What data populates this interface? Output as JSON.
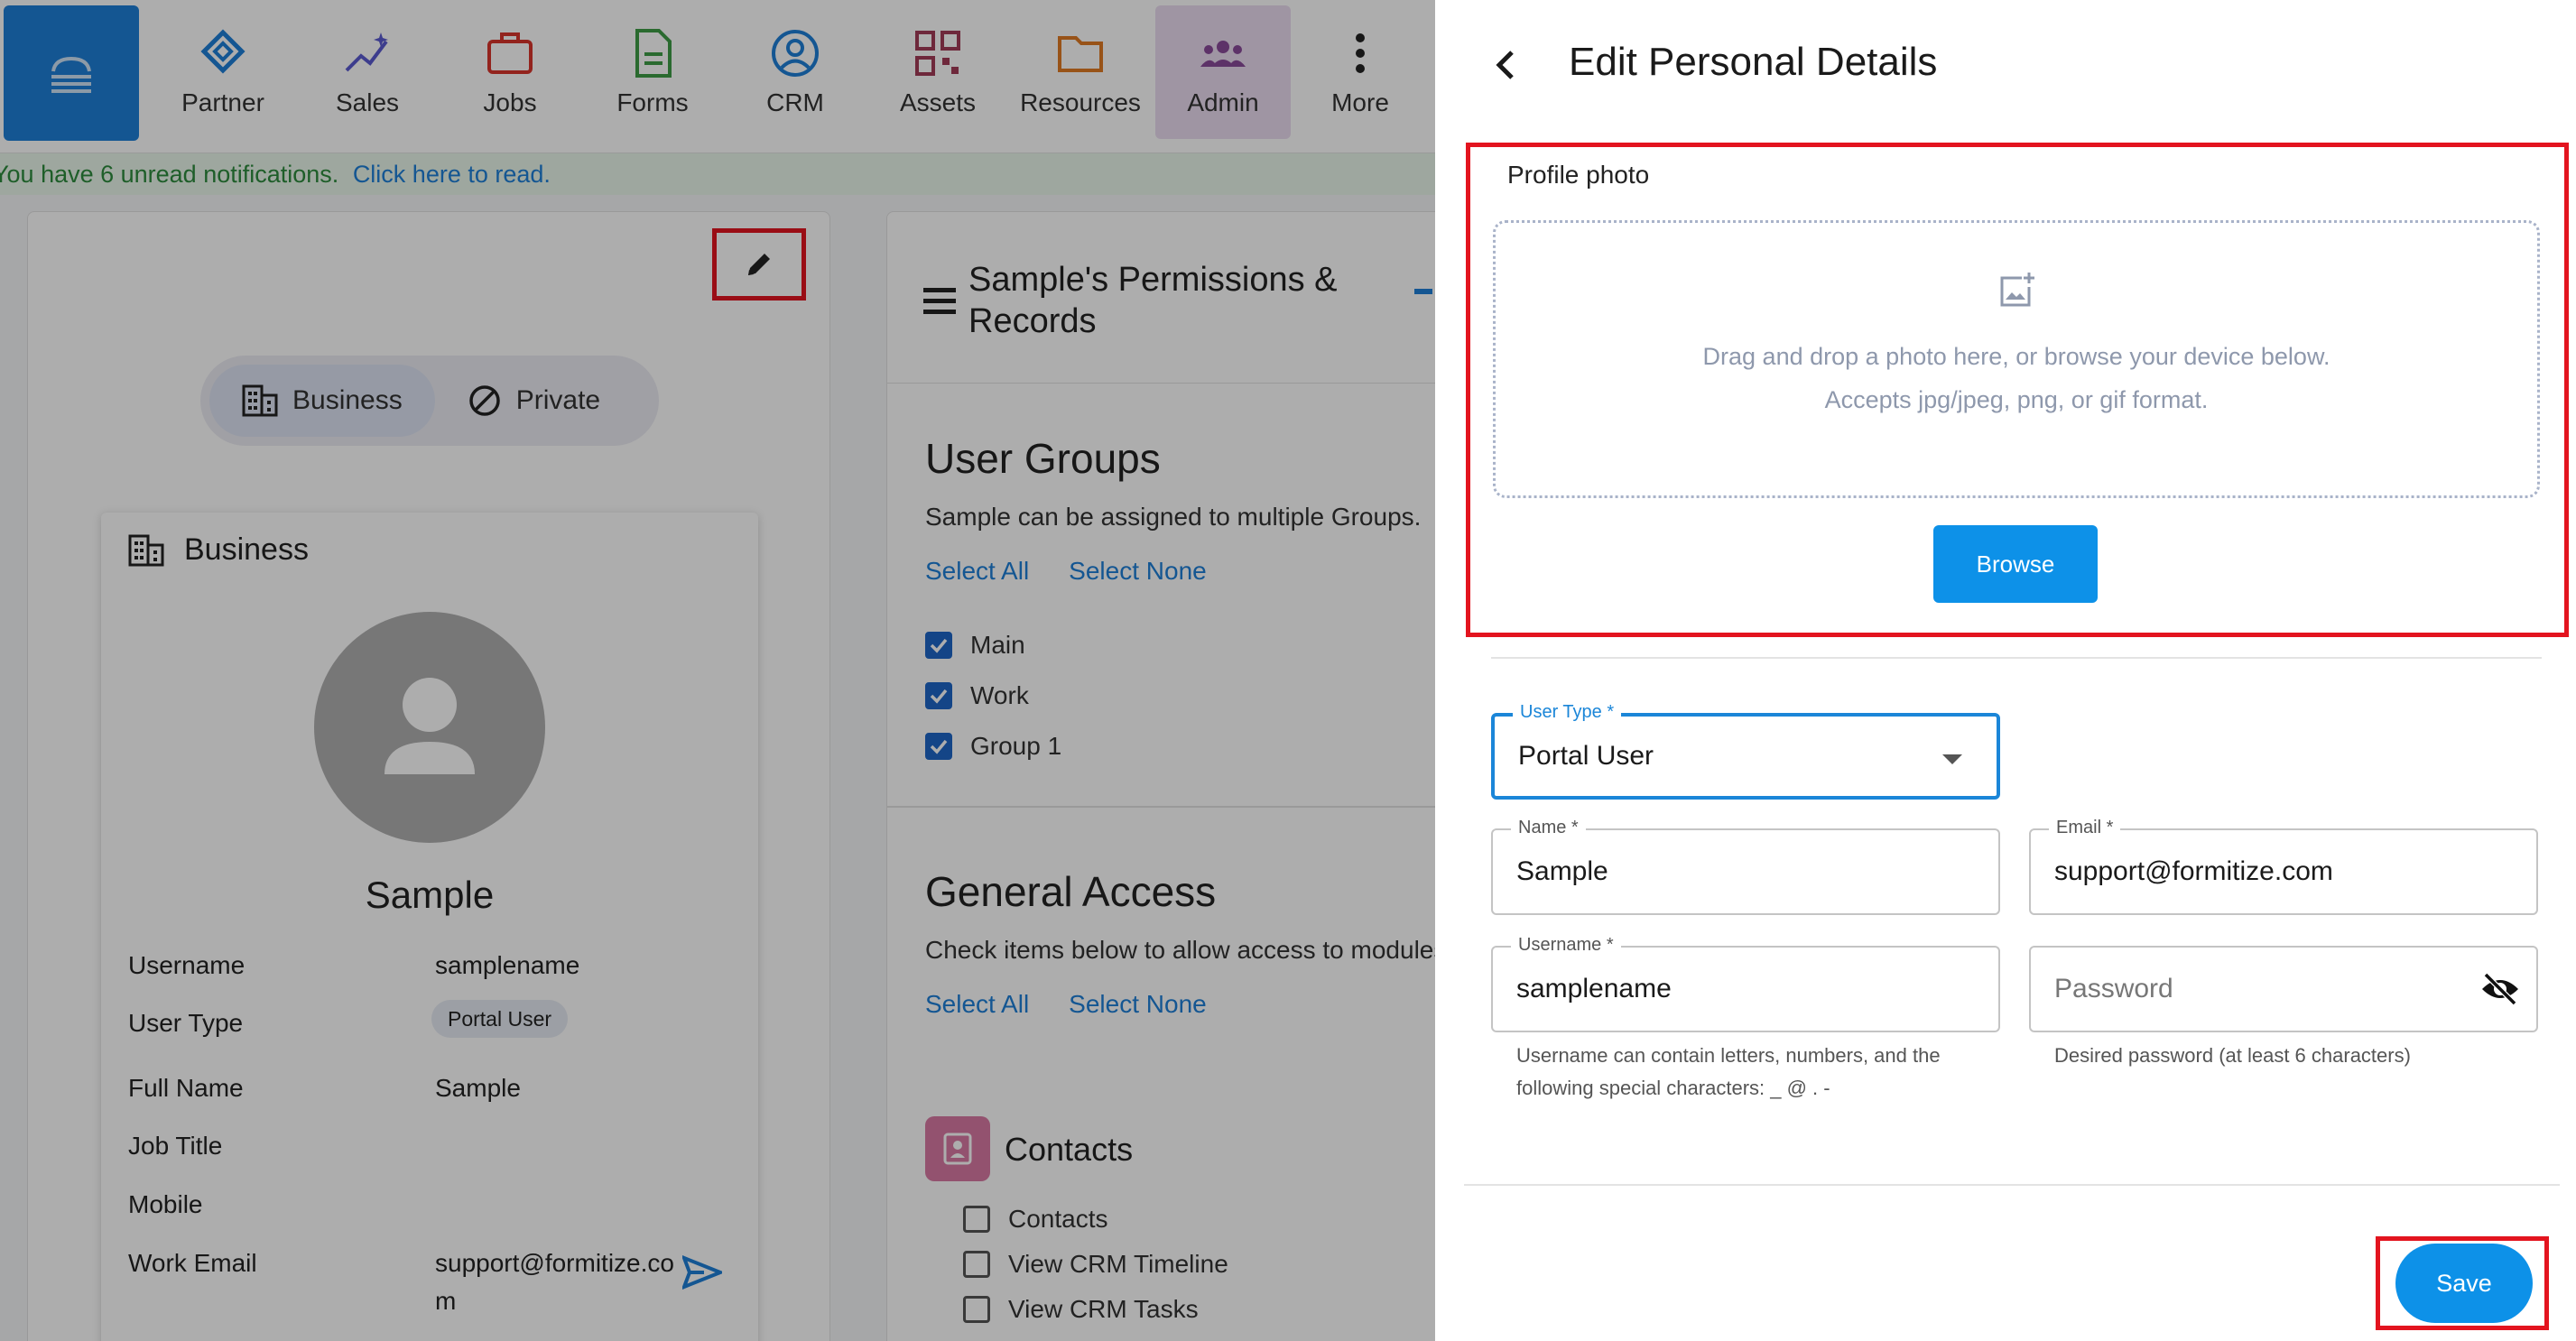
{
  "nav": {
    "items": [
      {
        "label": "Partner",
        "icon": "partner-icon"
      },
      {
        "label": "Sales",
        "icon": "sales-icon"
      },
      {
        "label": "Jobs",
        "icon": "briefcase-icon"
      },
      {
        "label": "Forms",
        "icon": "form-document-icon"
      },
      {
        "label": "CRM",
        "icon": "account-circle-icon"
      },
      {
        "label": "Assets",
        "icon": "qr-code-icon"
      },
      {
        "label": "Resources",
        "icon": "folder-icon"
      },
      {
        "label": "Admin",
        "icon": "group-icon"
      },
      {
        "label": "More",
        "icon": "more-vertical-icon"
      }
    ]
  },
  "notification": {
    "text": "You have 6 unread notifications.",
    "link": "Click here to read."
  },
  "profile": {
    "toggle": {
      "business": "Business",
      "private": "Private"
    },
    "card_title": "Business",
    "name": "Sample",
    "fields": [
      {
        "label": "Username",
        "value": "samplename"
      },
      {
        "label": "User Type",
        "value": "Portal User"
      },
      {
        "label": "Full Name",
        "value": "Sample"
      },
      {
        "label": "Job Title",
        "value": ""
      },
      {
        "label": "Mobile",
        "value": ""
      },
      {
        "label": "Work Email",
        "value": "support@formitize.co",
        "value_cont": "m"
      }
    ]
  },
  "permissions": {
    "title": "Sample's Permissions & Records",
    "user_groups": {
      "title": "User Groups",
      "subtitle": "Sample can be assigned to multiple Groups.",
      "select_all": "Select All",
      "select_none": "Select None",
      "groups": [
        {
          "label": "Main",
          "checked": true
        },
        {
          "label": "Work",
          "checked": true
        },
        {
          "label": "Group 1",
          "checked": true
        }
      ]
    },
    "general_access": {
      "title": "General Access",
      "subtitle": "Check items below to allow access to modules",
      "select_all": "Select All",
      "select_none": "Select None"
    },
    "contacts": {
      "title": "Contacts",
      "items": [
        {
          "label": "Contacts",
          "checked": false
        },
        {
          "label": "View CRM Timeline",
          "checked": false
        },
        {
          "label": "View CRM Tasks",
          "checked": false
        }
      ]
    }
  },
  "drawer": {
    "title": "Edit Personal Details",
    "profile_photo_label": "Profile photo",
    "drop_text_1": "Drag and drop a photo here, or browse your device below.",
    "drop_text_2": "Accepts jpg/jpeg, png, or gif format.",
    "browse_label": "Browse",
    "user_type": {
      "label": "User Type *",
      "value": "Portal User"
    },
    "name": {
      "label": "Name *",
      "value": "Sample"
    },
    "email": {
      "label": "Email *",
      "value": "support@formitize.com"
    },
    "username": {
      "label": "Username *",
      "value": "samplename",
      "helper_1": "Username can contain letters, numbers, and the",
      "helper_2": "following special characters: _ @ . -"
    },
    "password": {
      "placeholder": "Password",
      "helper": "Desired password (at least 6 characters)"
    },
    "save_label": "Save"
  },
  "colors": {
    "accent": "#0d91e8",
    "highlight": "#e3141f",
    "admin_bg": "#eadcf0"
  }
}
